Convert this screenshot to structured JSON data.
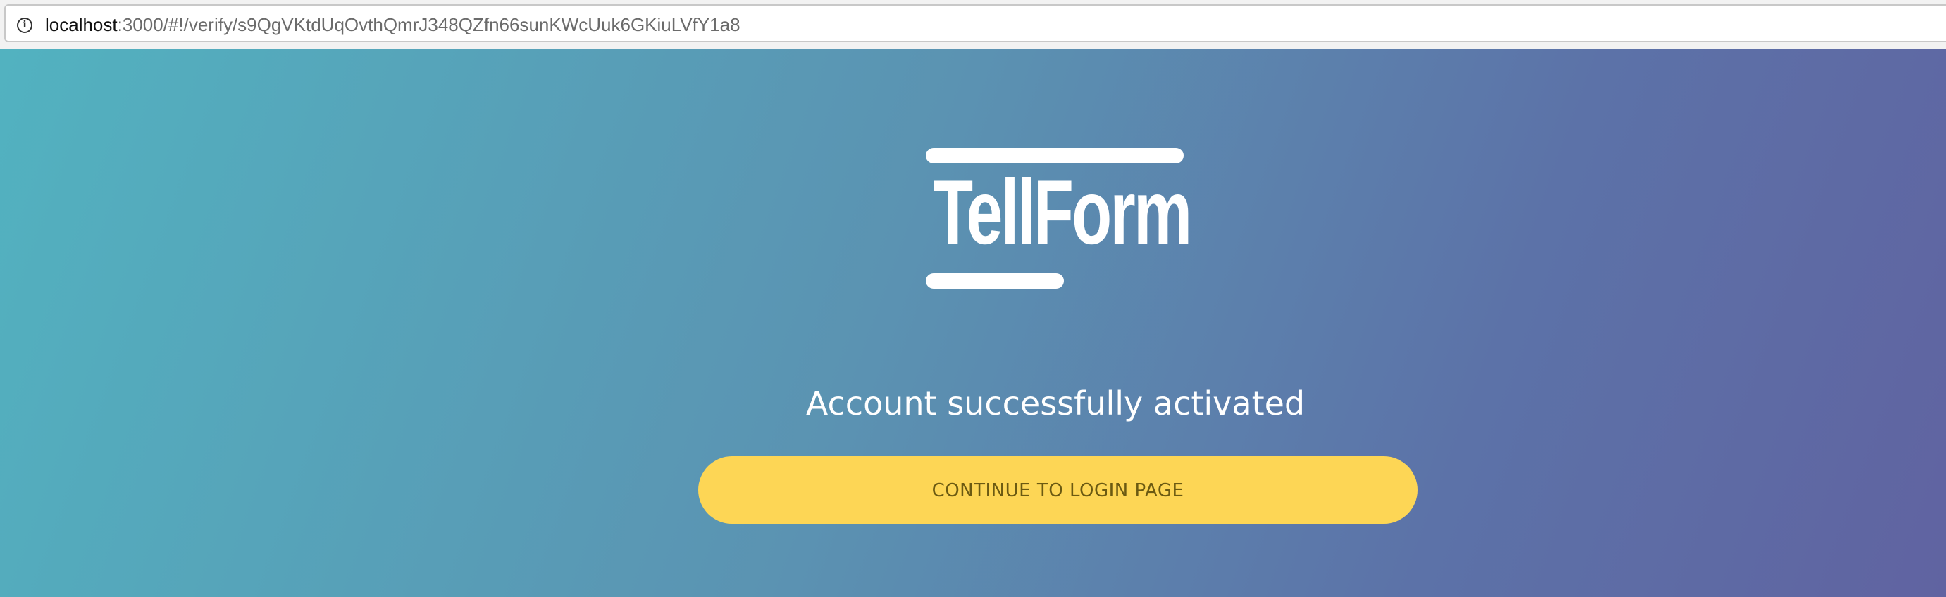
{
  "browser": {
    "url_host": "localhost",
    "url_path": ":3000/#!/verify/s9QgVKtdUqOvthQmrJ348QZfn66sunKWcUuk6GKiuLVfY1a8",
    "info_icon": "info-icon"
  },
  "logo": {
    "text": "TellForm"
  },
  "main": {
    "message": "Account successfully activated",
    "button_label": "CONTINUE TO LOGIN PAGE"
  },
  "colors": {
    "gradient_start": "#52b2c0",
    "gradient_end": "#6063a1",
    "button": "#fdd655",
    "button_text": "#6b5a12"
  }
}
